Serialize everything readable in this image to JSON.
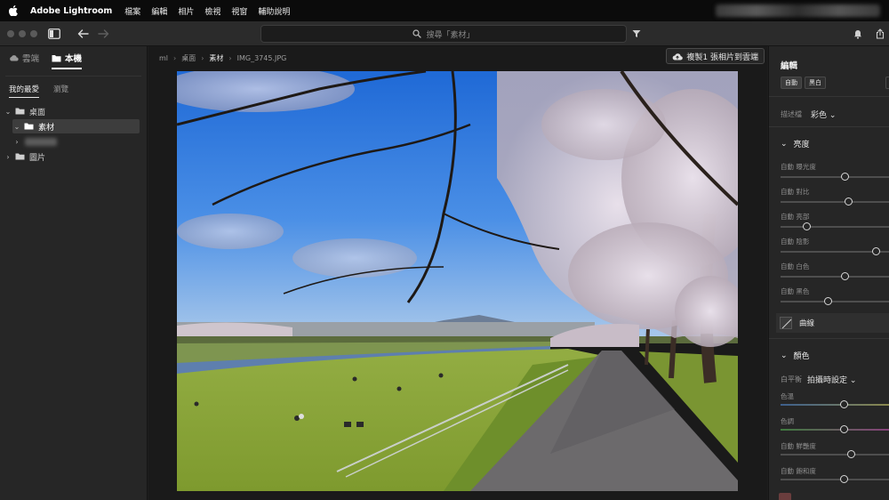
{
  "menubar": {
    "app_name": "Adobe Lightroom",
    "items": [
      "檔案",
      "編輯",
      "相片",
      "檢視",
      "視窗",
      "輔助說明"
    ]
  },
  "titlebar": {
    "search_placeholder": "搜尋「素材」"
  },
  "left": {
    "tabs": [
      "雲端",
      "本機"
    ],
    "active_tab": "本機",
    "sub_tabs": [
      "我的最愛",
      "瀏覽"
    ],
    "tree": [
      {
        "label": "桌面",
        "expanded": true
      },
      {
        "label": "素材",
        "expanded": true,
        "selected": true
      },
      {
        "label": ""
      },
      {
        "label": "圖片",
        "expanded": false
      }
    ]
  },
  "center": {
    "breadcrumb": [
      "ml",
      "桌面",
      "素材",
      "IMG_3745.JPG"
    ],
    "copy_button": "複製1 張相片到雲端"
  },
  "right": {
    "title": "編輯",
    "mode_buttons": [
      "自動",
      "黑白"
    ],
    "profile_label": "描述檔",
    "profile_value": "彩色",
    "sections": {
      "light": "亮度",
      "color": "顏色",
      "curve": "曲線"
    },
    "light_sliders": [
      {
        "label": "自動 曝光度",
        "value": 0.57
      },
      {
        "label": "自動 對比",
        "value": 0.6
      },
      {
        "label": "自動 亮部",
        "value": 0.23
      },
      {
        "label": "自動 陰影",
        "value": 0.84
      },
      {
        "label": "自動 白色",
        "value": 0.57
      },
      {
        "label": "自動 黑色",
        "value": 0.42
      }
    ],
    "wb_label": "白平衡",
    "wb_value": "拍攝時設定",
    "color_sliders": [
      {
        "label": "色溫",
        "value": 0.56
      },
      {
        "label": "色調",
        "value": 0.56
      },
      {
        "label": "自動 鮮艷度",
        "value": 0.62
      },
      {
        "label": "自動 飽和度",
        "value": 0.56
      }
    ]
  }
}
